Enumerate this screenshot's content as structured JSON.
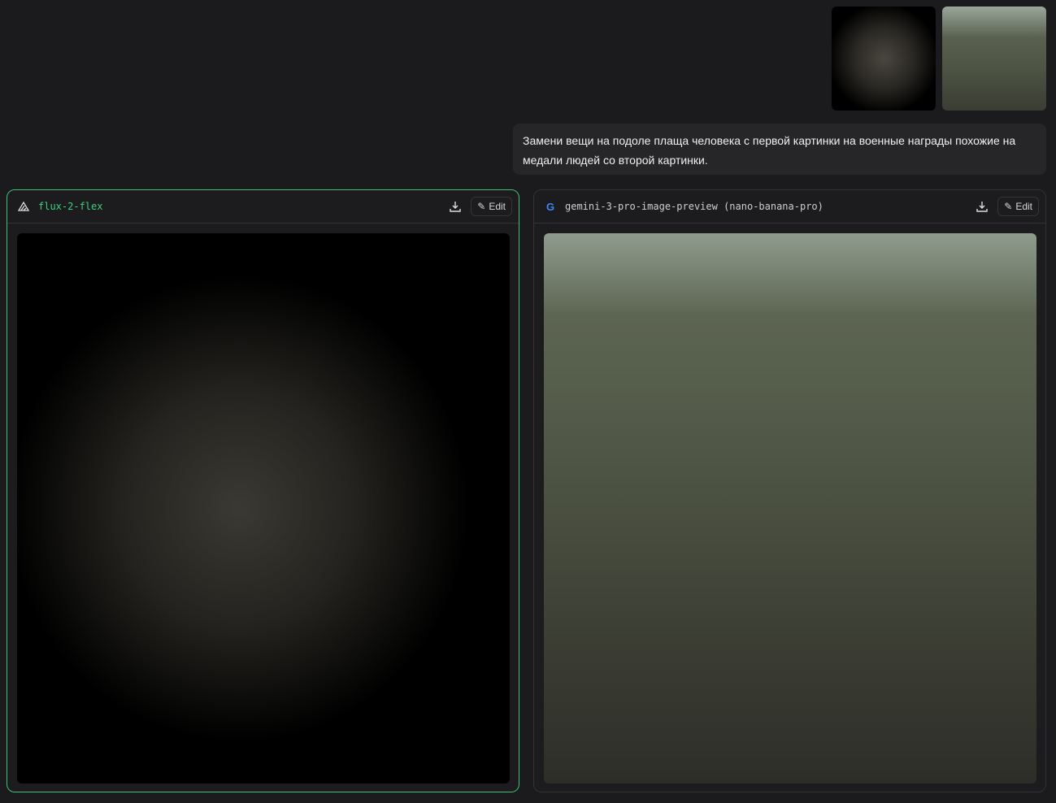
{
  "attachments": [
    {
      "name": "hooded-figure-image"
    },
    {
      "name": "military-officers-image"
    }
  ],
  "prompt": "Замени вещи на подоле плаща человека с первой картинки на военные награды похожие на медали людей со второй картинки.",
  "results": [
    {
      "model": "flux-2-flex",
      "icon": "flux-logo-icon",
      "edit_label": "Edit",
      "accent": "#3fcf7e"
    },
    {
      "model": "gemini-3-pro-image-preview (nano-banana-pro)",
      "icon": "google-logo-icon",
      "edit_label": "Edit"
    }
  ]
}
